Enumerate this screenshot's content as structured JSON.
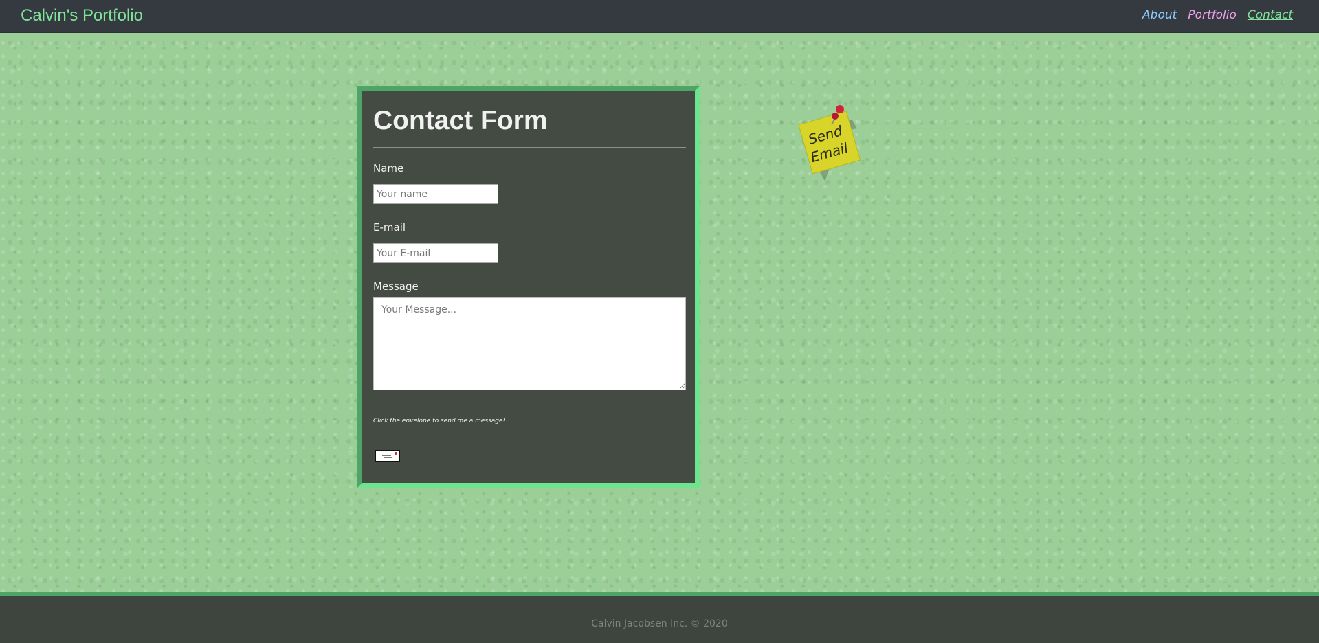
{
  "navbar": {
    "brand": "Calvin's Portfolio",
    "links": [
      {
        "label": "About",
        "color": "#8ecbff"
      },
      {
        "label": "Portfolio",
        "color": "#f0a0e8"
      },
      {
        "label": "Contact",
        "color": "#7fe39a"
      }
    ]
  },
  "form": {
    "title": "Contact Form",
    "name_label": "Name",
    "name_placeholder": "Your name",
    "email_label": "E-mail",
    "email_placeholder": "Your E-mail",
    "message_label": "Message",
    "message_placeholder": "Your Message...",
    "hint": "Click the envelope to send me a message!",
    "submit_icon": "envelope-icon"
  },
  "sticky_note": {
    "text": "Send Email",
    "icon": "pushpin-icon"
  },
  "footer": {
    "copyright": "Calvin Jacobsen Inc. © 2020"
  },
  "colors": {
    "background": "#9ccf98",
    "navbar": "#343a40",
    "accent": "#7fe39a",
    "card": "#444b43",
    "card_border": "#4fa567"
  }
}
